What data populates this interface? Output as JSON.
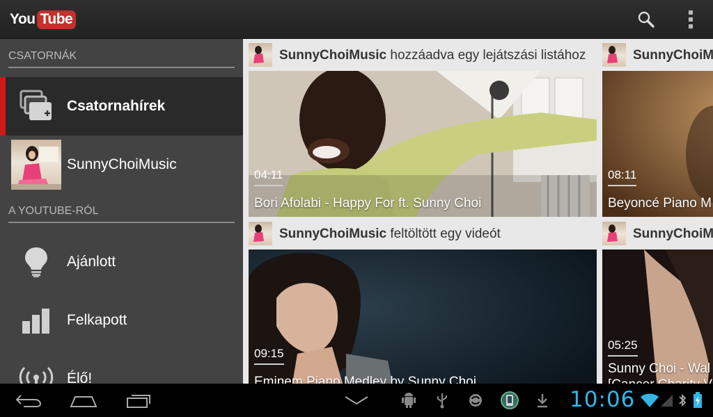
{
  "app": {
    "logo_you": "You",
    "logo_tube": "Tube"
  },
  "sidebar": {
    "section_channels": "CSATORNÁK",
    "section_youtube": "A YOUTUBE-RÓL",
    "items": [
      {
        "label": "Csatornahírek",
        "icon": "channel-feed-icon",
        "selected": true
      },
      {
        "label": "SunnyChoiMusic",
        "icon": "channel-avatar"
      },
      {
        "label": "Ajánlott",
        "icon": "lightbulb-icon"
      },
      {
        "label": "Felkapott",
        "icon": "bar-chart-icon"
      },
      {
        "label": "Élő!",
        "icon": "broadcast-icon"
      }
    ],
    "accent_color": "#cc1a1a"
  },
  "feed": {
    "cards": [
      {
        "user": "SunnyChoiMusic",
        "action": "hozzáadva egy lejátszási listához",
        "duration": "04:11",
        "title": "Bori Afolabi - Happy For ft. Sunny Choi"
      },
      {
        "user": "SunnyChoiMusic",
        "action": "",
        "duration": "08:11",
        "title": "Beyoncé Piano M"
      },
      {
        "user": "SunnyChoiMusic",
        "action": "feltöltött egy videót",
        "duration": "09:15",
        "title": "Eminem Piano Medley by Sunny Choi"
      },
      {
        "user": "SunnyChoiMusic",
        "action": "",
        "duration": "05:25",
        "title": "Sunny Choi - Wal",
        "title_line2": "[Cancer Charity V"
      }
    ]
  },
  "systembar": {
    "time": "10:06",
    "accent_color": "#33b5e5"
  }
}
